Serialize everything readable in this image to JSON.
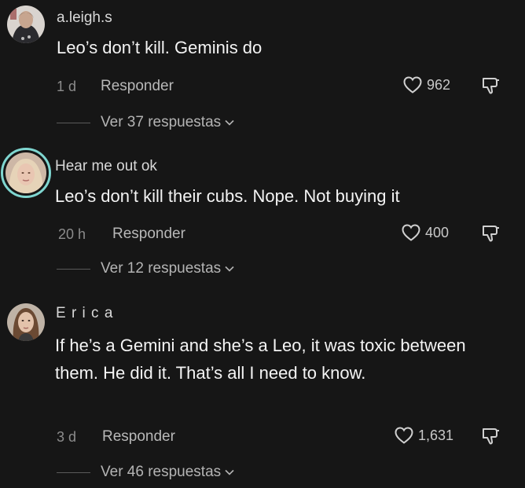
{
  "comments": [
    {
      "username": "a.leigh.s",
      "text": "Leo’s don’t kill. Geminis do",
      "time": "1 d",
      "reply_label": "Responder",
      "likes": "962",
      "view_replies": "Ver 37 respuestas"
    },
    {
      "username": "Hear me out ok",
      "text": "Leo’s don’t kill their cubs. Nope. Not buying it",
      "time": "20 h",
      "reply_label": "Responder",
      "likes": "400",
      "view_replies": "Ver 12 respuestas"
    },
    {
      "username": "E r i c a",
      "text": "If he’s a Gemini and she’s a Leo, it was toxic between them. He did it. That’s all I need to know.",
      "time": "3 d",
      "reply_label": "Responder",
      "likes": "1,631",
      "view_replies": "Ver 46 respuestas"
    }
  ],
  "icons": {
    "like": "heart-outline-icon",
    "dislike": "thumbs-down-icon",
    "expand": "chevron-down-icon"
  },
  "colors": {
    "background": "#161616",
    "story_ring": "#7fd6d0"
  }
}
